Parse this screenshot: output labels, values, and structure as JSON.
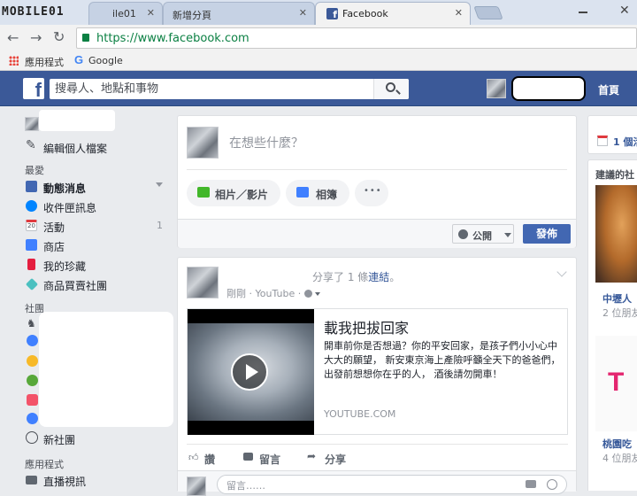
{
  "browser": {
    "tabs": [
      {
        "label": "ile01"
      },
      {
        "label": "新增分頁"
      },
      {
        "label": "Facebook"
      }
    ],
    "logo_text": "MOBILE01",
    "url": "https://www.facebook.com",
    "bookmarks": {
      "apps_label": "應用程式",
      "google_label": "Google"
    }
  },
  "fb_header": {
    "logo": "f",
    "search_placeholder": "搜尋人、地點和事物",
    "home_label": "首頁"
  },
  "left_nav": {
    "edit_profile": "編輯個人檔案",
    "favorites_heading": "最愛",
    "favorites": [
      {
        "label": "動態消息",
        "count": ""
      },
      {
        "label": "收件匣訊息",
        "count": ""
      },
      {
        "label": "活動",
        "count": "1"
      },
      {
        "label": "商店",
        "count": ""
      },
      {
        "label": "我的珍藏",
        "count": ""
      },
      {
        "label": "商品買賣社團",
        "count": ""
      }
    ],
    "groups_heading": "社團",
    "new_group": "新社團",
    "apps_heading": "應用程式",
    "live_video": "直播視訊",
    "calendar_day": "20"
  },
  "composer": {
    "placeholder": "在想些什麼？",
    "photo_video": "相片／影片",
    "album": "相簿",
    "more": "•••",
    "audience": "公開",
    "post_button": "發佈"
  },
  "post": {
    "shared_text_prefix": "分享了 1 條",
    "shared_text_link": "連結",
    "shared_text_suffix": "。",
    "time": "剛剛",
    "source": "YouTube",
    "link_title": "載我把拔回家",
    "link_desc": "開車前你是否想過？你的平安回家，是孩子們小小心中 大大的願望， 新安東京海上產險呼籲全天下的爸爸們， 出發前想想你在乎的人， 酒後請勿開車！",
    "link_domain": "YOUTUBE.COM",
    "like": "讚",
    "comment": "留言",
    "share": "分享",
    "comment_placeholder": "留言……"
  },
  "right_col": {
    "events_text": "1 個活",
    "suggested_heading": "建議的社",
    "suggestions": [
      {
        "name": "中壢人",
        "meta": "2 位朋友"
      },
      {
        "name": "桃園吃",
        "meta": "4 位朋友"
      }
    ]
  },
  "colors": {
    "fb_blue": "#3b5998",
    "button_blue": "#4267b2",
    "link_blue": "#365899"
  }
}
